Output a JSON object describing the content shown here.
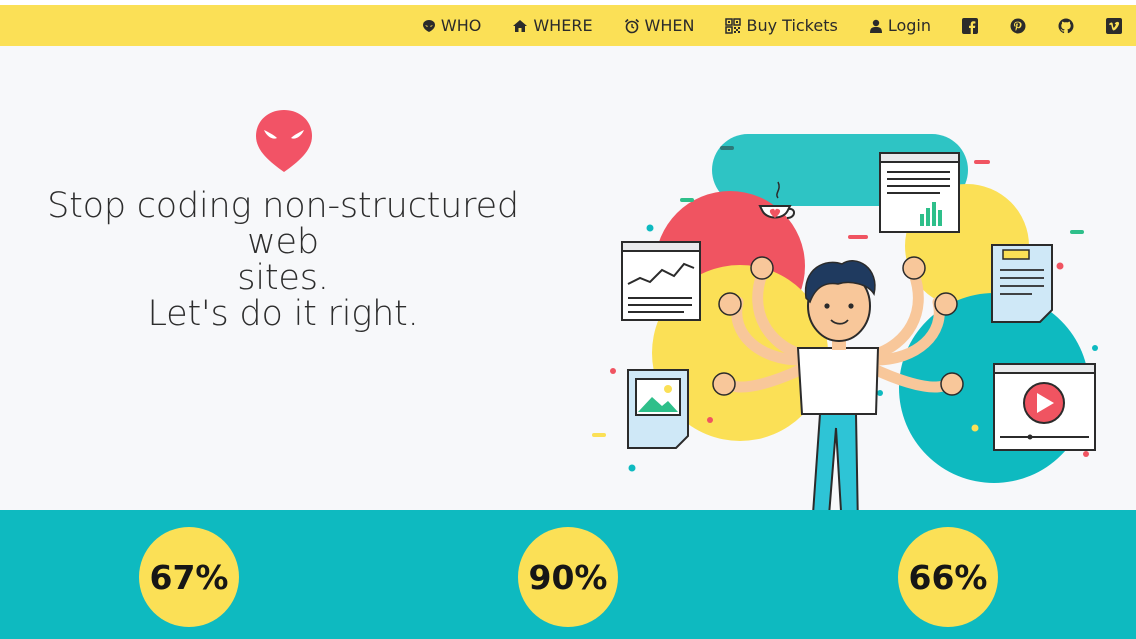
{
  "nav": {
    "items": [
      {
        "label": "WHO",
        "icon": "alien-icon"
      },
      {
        "label": "WHERE",
        "icon": "home-icon"
      },
      {
        "label": "WHEN",
        "icon": "alarm-clock-icon"
      },
      {
        "label": "Buy Tickets",
        "icon": "qrcode-icon"
      },
      {
        "label": "Login",
        "icon": "user-icon"
      }
    ],
    "social": [
      "facebook-icon",
      "pinterest-icon",
      "github-icon",
      "vimeo-icon"
    ]
  },
  "hero": {
    "line1": "Stop coding non-structured web",
    "line2": "sites.",
    "line3": "Let's do it right."
  },
  "stats": [
    {
      "value": "67%"
    },
    {
      "value": "90%"
    },
    {
      "value": "66%"
    }
  ],
  "colors": {
    "nav_bg": "#fbe056",
    "hero_bg": "#f7f8fa",
    "stats_bg": "#0ebac0",
    "circle_bg": "#fbe056",
    "logo": "#f25366"
  }
}
